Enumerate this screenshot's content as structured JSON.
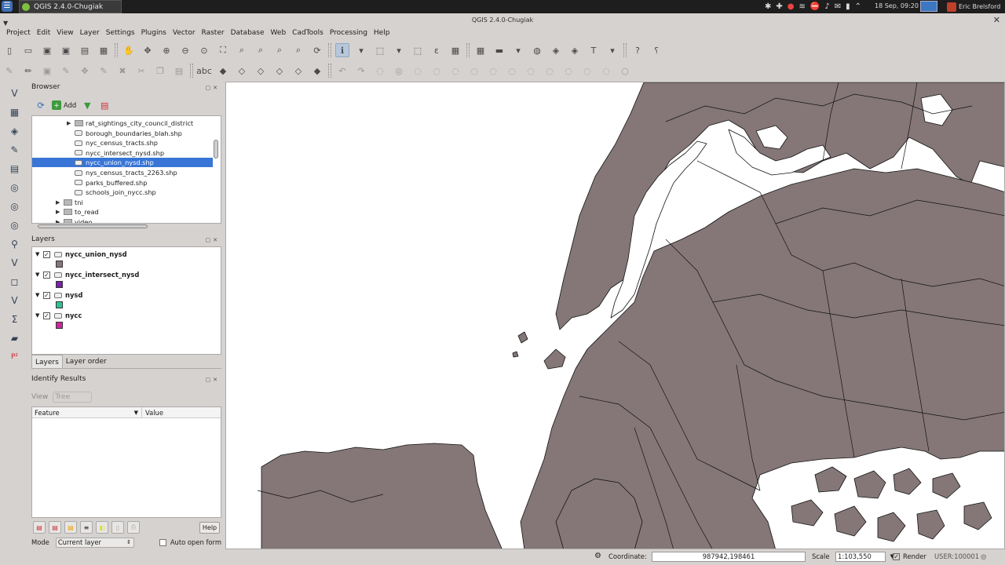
{
  "taskbar": {
    "app_title": "QGIS 2.4.0-Chugiak",
    "clock": "18 Sep, 09:20",
    "user": "Eric Brelsford",
    "tray_icons": [
      "bluetooth-icon",
      "network-icon",
      "record-icon",
      "wifi-icon",
      "stop-icon",
      "volume-icon",
      "mail-icon",
      "battery-icon",
      "chevron-icon"
    ]
  },
  "window": {
    "title": "QGIS 2.4.0-Chugiak",
    "close_glyph": "✕"
  },
  "menu": [
    "Project",
    "Edit",
    "View",
    "Layer",
    "Settings",
    "Plugins",
    "Vector",
    "Raster",
    "Database",
    "Web",
    "CadTools",
    "Processing",
    "Help"
  ],
  "toolbar1_icons": [
    "new-project-icon",
    "open-project-icon",
    "save-project-icon",
    "save-as-icon",
    "new-print-composer-icon",
    "composer-manager-icon",
    "pan-icon",
    "pan-to-selection-icon",
    "zoom-in-icon",
    "zoom-out-icon",
    "zoom-native-icon",
    "zoom-full-icon",
    "zoom-to-selection-icon",
    "zoom-to-layer-icon",
    "zoom-last-icon",
    "zoom-next-icon",
    "refresh-icon",
    "identify-icon",
    "identify-dropdown-icon",
    "select-feature-icon",
    "select-dropdown-icon",
    "deselect-icon",
    "expression-select-icon",
    "attribute-table-icon",
    "field-calculator-icon",
    "measure-icon",
    "measure-dropdown-icon",
    "map-tips-icon",
    "new-bookmark-icon",
    "show-bookmarks-icon",
    "text-annotation-icon",
    "annotation-dropdown-icon",
    "help-contents-icon",
    "whats-this-icon"
  ],
  "toolbar2_icons": [
    "current-edits-icon",
    "toggle-editing-icon",
    "save-edits-icon",
    "add-feature-icon",
    "move-feature-icon",
    "node-tool-icon",
    "delete-selected-icon",
    "cut-features-icon",
    "copy-features-icon",
    "paste-features-icon",
    "label-icon",
    "pin-labels-icon",
    "show-hide-labels-icon",
    "move-label-icon",
    "rotate-label-icon",
    "change-label-icon",
    "python-icon",
    "undo-icon",
    "redo-icon",
    "simplify-icon",
    "add-ring-icon",
    "add-part-icon",
    "fill-ring-icon",
    "delete-ring-icon",
    "delete-part-icon",
    "reshape-icon",
    "offset-curve-icon",
    "split-features-icon",
    "split-parts-icon",
    "merge-selected-icon",
    "merge-attributes-icon",
    "rotate-point-icon",
    "circle-icon"
  ],
  "left_tools": [
    "add-vector-layer-icon",
    "add-raster-layer-icon",
    "add-postgis-icon",
    "add-spatialite-icon",
    "add-mssql-icon",
    "add-wms-icon",
    "add-wcs-icon",
    "add-wfs-icon",
    "add-delimited-text-icon",
    "new-shapefile-icon",
    "new-spatialite-icon",
    "new-gpx-icon",
    "sum-icon",
    "ruler-icon",
    "p2-icon"
  ],
  "browser": {
    "title": "Browser",
    "add_label": "Add",
    "items": [
      {
        "label": "rat_sightings_city_council_district",
        "kind": "folder",
        "expanded": false,
        "level": 2
      },
      {
        "label": "borough_boundaries_blah.shp",
        "kind": "shp",
        "level": 2
      },
      {
        "label": "nyc_census_tracts.shp",
        "kind": "shp",
        "level": 2
      },
      {
        "label": "nycc_intersect_nysd.shp",
        "kind": "shp",
        "level": 2
      },
      {
        "label": "nycc_union_nysd.shp",
        "kind": "shp",
        "level": 2,
        "selected": true
      },
      {
        "label": "nys_census_tracts_2263.shp",
        "kind": "shp",
        "level": 2
      },
      {
        "label": "parks_buffered.shp",
        "kind": "shp",
        "level": 2
      },
      {
        "label": "schools_join_nycc.shp",
        "kind": "shp",
        "level": 2
      },
      {
        "label": "tni",
        "kind": "folder",
        "level": 1
      },
      {
        "label": "to_read",
        "kind": "folder",
        "level": 1
      },
      {
        "label": "video",
        "kind": "folder",
        "level": 1
      }
    ]
  },
  "layers": {
    "title": "Layers",
    "items": [
      {
        "name": "nycc_union_nysd",
        "color": "#857777",
        "checked": true
      },
      {
        "name": "nycc_intersect_nysd",
        "color": "#7a1fa8",
        "checked": true
      },
      {
        "name": "nysd",
        "color": "#2ec398",
        "checked": true
      },
      {
        "name": "nycc",
        "color": "#c52a9b",
        "checked": true
      }
    ],
    "tabs": [
      "Layers",
      "Layer order"
    ]
  },
  "identify": {
    "title": "Identify Results",
    "view_label": "View",
    "view_value": "Tree",
    "col_feature": "Feature",
    "col_value": "Value",
    "help_label": "Help",
    "mode_label": "Mode",
    "mode_value": "Current layer",
    "auto_open_label": "Auto open form"
  },
  "status": {
    "coordinate_label": "Coordinate:",
    "coordinate_value": "987942,198461",
    "scale_label": "Scale",
    "scale_value": "1:103,550",
    "render_label": "Render",
    "crs": "USER:100001"
  },
  "map": {
    "fill_color": "#857777",
    "stroke_color": "#111111",
    "background": "#ffffff"
  }
}
